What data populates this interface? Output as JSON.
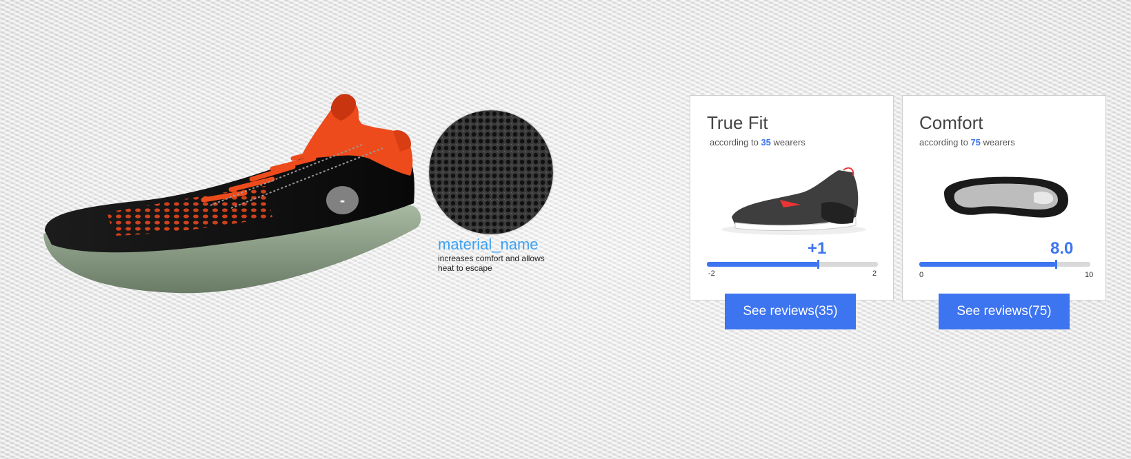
{
  "hotspot": {
    "label": "-"
  },
  "material": {
    "name": "material_name",
    "description": "increases comfort and allows heat to escape"
  },
  "cards": [
    {
      "title": "True Fit",
      "sub_prefix": "according to",
      "count": "35",
      "sub_suffix": "wearers",
      "score": "+1",
      "min_label": "-2",
      "max_label": "2",
      "value_fraction": 0.65,
      "button_label": "See reviews(35)",
      "image": "side-view-sneaker"
    },
    {
      "title": "Comfort",
      "sub_prefix": "according to",
      "count": "75",
      "sub_suffix": "wearers",
      "score": "8.0",
      "min_label": "0",
      "max_label": "10",
      "value_fraction": 0.8,
      "button_label": "See reviews(75)",
      "image": "sole-view-sneaker"
    }
  ],
  "colors": {
    "accent": "#3d74ef",
    "material_link": "#3aa0f2"
  }
}
